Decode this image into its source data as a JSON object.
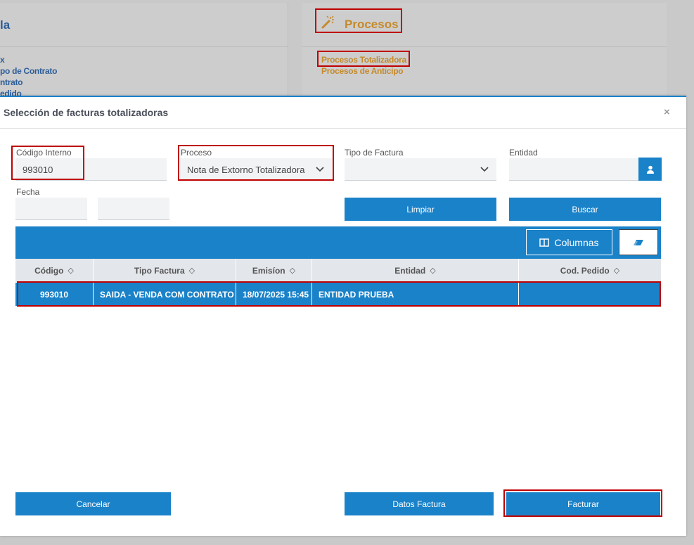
{
  "background": {
    "left_title": "la",
    "left_links": [
      "x",
      "po de Contrato",
      "ntrato",
      "edido"
    ],
    "procesos_title": "Procesos",
    "procesos_links": [
      "Procesos Totalizadora",
      "Procesos de Anticipo"
    ]
  },
  "modal": {
    "title": "Selección de facturas totalizadoras",
    "close_glyph": "×",
    "fields": {
      "codigo_interno_label": "Código Interno",
      "codigo_interno_value": "993010",
      "proceso_label": "Proceso",
      "proceso_value": "Nota de Extorno Totalizadora",
      "tipo_factura_label": "Tipo de Factura",
      "tipo_factura_value": "",
      "entidad_label": "Entidad",
      "entidad_value": "",
      "fecha_label": "Fecha",
      "fecha_from": "",
      "fecha_to": ""
    },
    "buttons": {
      "limpiar": "Limpiar",
      "buscar": "Buscar",
      "cancelar": "Cancelar",
      "datos_factura": "Datos Factura",
      "facturar": "Facturar"
    },
    "table": {
      "columns_button": "Columnas",
      "headers": [
        "Código",
        "Tipo Factura",
        "Emisíon",
        "Entidad",
        "Cod. Pedido"
      ],
      "sort_glyph": "◇",
      "rows": [
        {
          "codigo": "993010",
          "tipo_factura": "SAIDA - VENDA COM CONTRATO",
          "emision": "18/07/2025 15:45",
          "entidad": "ENTIDAD PRUEBA",
          "cod_pedido": ""
        }
      ]
    }
  },
  "colors": {
    "primary": "#1a82c9",
    "highlight_border": "#c00000",
    "procesos_gold": "#c58a2b",
    "link_blue": "#2d5d98"
  }
}
